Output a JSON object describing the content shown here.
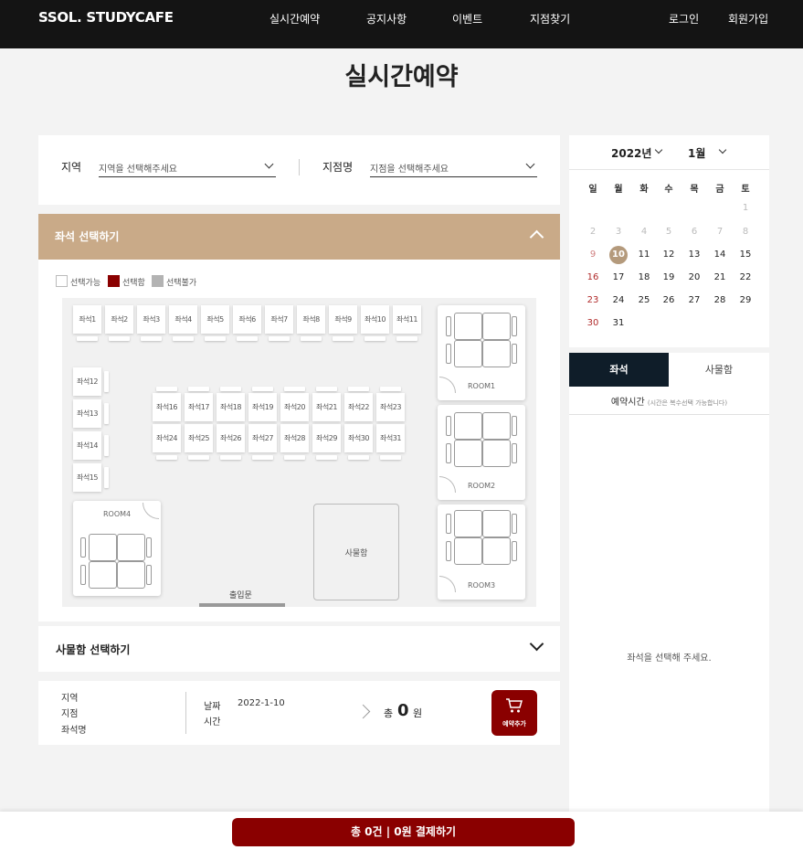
{
  "header": {
    "logo": "SSOL. STUDYCAFE",
    "nav": [
      "실시간예약",
      "공지사항",
      "이벤트",
      "지점찾기"
    ],
    "login": "로그인",
    "signup": "회원가입"
  },
  "page_title": "실시간예약",
  "filter": {
    "region_label": "지역",
    "region_placeholder": "지역을 선택해주세요",
    "branch_label": "지점명",
    "branch_placeholder": "지점을 선택해주세요"
  },
  "seat_section": {
    "title": "좌석 선택하기",
    "legend": [
      "선택가능",
      "선택함",
      "선택불가"
    ],
    "legend_colors": [
      "#ffffff",
      "#8a0000",
      "#b3b3b3"
    ],
    "seats": [
      "좌석1",
      "좌석2",
      "좌석3",
      "좌석4",
      "좌석5",
      "좌석6",
      "좌석7",
      "좌석8",
      "좌석9",
      "좌석10",
      "좌석11",
      "좌석12",
      "좌석13",
      "좌석14",
      "좌석15",
      "좌석16",
      "좌석17",
      "좌석18",
      "좌석19",
      "좌석20",
      "좌석21",
      "좌석22",
      "좌석23",
      "좌석24",
      "좌석25",
      "좌석26",
      "좌석27",
      "좌석28",
      "좌석29",
      "좌석30",
      "좌석31"
    ],
    "rooms": [
      "ROOM1",
      "ROOM2",
      "ROOM3",
      "ROOM4"
    ],
    "locker_area": "사물함",
    "entrance": "출입문"
  },
  "locker_section": {
    "title": "사물함 선택하기"
  },
  "summary": {
    "region": "지역",
    "branch": "지점",
    "seat_name": "좌석명",
    "date_label": "날짜",
    "date_value": "2022-1-10",
    "time_label": "시간",
    "total_prefix": "총",
    "total_amount": "0",
    "total_unit": "원",
    "add_button": "예약추가"
  },
  "calendar": {
    "year": "2022년",
    "month": "1월",
    "weekdays": [
      "일",
      "월",
      "화",
      "수",
      "목",
      "금",
      "토"
    ],
    "prev_days": [
      "2",
      "3",
      "4",
      "5",
      "6",
      "7",
      "8",
      "1"
    ],
    "days": [
      "9",
      "10",
      "11",
      "12",
      "13",
      "14",
      "15",
      "16",
      "17",
      "18",
      "19",
      "20",
      "21",
      "22",
      "23",
      "24",
      "25",
      "26",
      "27",
      "28",
      "29",
      "30",
      "31"
    ],
    "selected_day": "10",
    "accent_color": "#b49a7c"
  },
  "side_tabs": [
    "좌석",
    "사물함"
  ],
  "reserve_time": {
    "label": "예약시간",
    "note": "(시간은 복수선택 가능합니다)"
  },
  "empty_message": "좌석을 선택해 주세요.",
  "pay_bar": {
    "text": "총 0건 | 0원  결제하기"
  }
}
